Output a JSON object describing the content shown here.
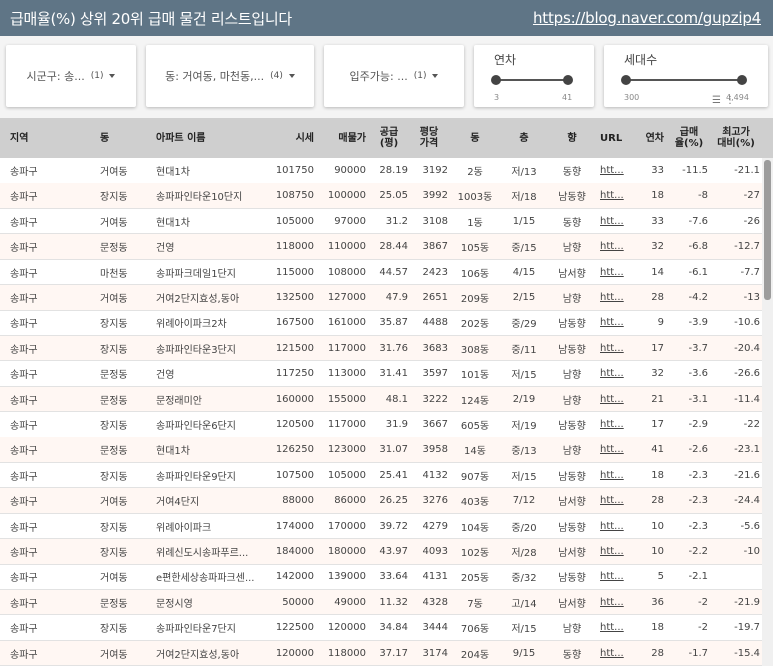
{
  "header": {
    "title": "급매율(%) 상위 20위 급매 물건 리스트입니다",
    "link": "https://blog.naver.com/gupzip4"
  },
  "filters": {
    "sigungu": {
      "label": "시군구: 송...",
      "count": "(1)"
    },
    "dong": {
      "label": "동: 거여동, 마천동,...",
      "count": "(4)"
    },
    "movein": {
      "label": "입주가능: ...",
      "count": "(1)"
    },
    "year": {
      "title": "연차",
      "min": "3",
      "max": "41",
      "range_low": 0.0,
      "range_high": 1.0
    },
    "households": {
      "title": "세대수",
      "min": "300",
      "max": "4,494",
      "range_low": 0.0,
      "range_high": 1.0
    }
  },
  "table": {
    "columns": [
      {
        "key": "region",
        "label": "지역"
      },
      {
        "key": "dong",
        "label": "동"
      },
      {
        "key": "apt",
        "label": "아파트 이름"
      },
      {
        "key": "price",
        "label": "시세"
      },
      {
        "key": "sale",
        "label": "매물가"
      },
      {
        "key": "area",
        "label": "공급\n(평)"
      },
      {
        "key": "ppa",
        "label": "평당\n가격"
      },
      {
        "key": "bldg",
        "label": "동"
      },
      {
        "key": "floor",
        "label": "층"
      },
      {
        "key": "dir",
        "label": "향"
      },
      {
        "key": "url",
        "label": "URL"
      },
      {
        "key": "age",
        "label": "연차"
      },
      {
        "key": "rate",
        "label": "급매\n율(%)"
      },
      {
        "key": "peak",
        "label": "최고가\n대비(%)"
      }
    ],
    "rows": [
      [
        "송파구",
        "거여동",
        "현대1차",
        "101750",
        "90000",
        "28.19",
        "3192",
        "2동",
        "저/13",
        "동향",
        "htt...",
        "33",
        "-11.5",
        "-21.1"
      ],
      [
        "송파구",
        "장지동",
        "송파파인타운10단지",
        "108750",
        "100000",
        "25.05",
        "3992",
        "1003동",
        "저/18",
        "남동향",
        "htt...",
        "18",
        "-8",
        "-27"
      ],
      [
        "송파구",
        "거여동",
        "현대1차",
        "105000",
        "97000",
        "31.2",
        "3108",
        "1동",
        "1/15",
        "동향",
        "htt...",
        "33",
        "-7.6",
        "-26"
      ],
      [
        "송파구",
        "문정동",
        "건영",
        "118000",
        "110000",
        "28.44",
        "3867",
        "105동",
        "중/15",
        "남향",
        "htt...",
        "32",
        "-6.8",
        "-12.7"
      ],
      [
        "송파구",
        "마천동",
        "송파파크데일1단지",
        "115000",
        "108000",
        "44.57",
        "2423",
        "106동",
        "4/15",
        "남서향",
        "htt...",
        "14",
        "-6.1",
        "-7.7"
      ],
      [
        "송파구",
        "거여동",
        "거여2단지효성,동아",
        "132500",
        "127000",
        "47.9",
        "2651",
        "209동",
        "2/15",
        "남향",
        "htt...",
        "28",
        "-4.2",
        "-13"
      ],
      [
        "송파구",
        "장지동",
        "위례아이파크2차",
        "167500",
        "161000",
        "35.87",
        "4488",
        "202동",
        "중/29",
        "남동향",
        "htt...",
        "9",
        "-3.9",
        "-10.6"
      ],
      [
        "송파구",
        "장지동",
        "송파파인타운3단지",
        "121500",
        "117000",
        "31.76",
        "3683",
        "308동",
        "중/11",
        "남동향",
        "htt...",
        "17",
        "-3.7",
        "-20.4"
      ],
      [
        "송파구",
        "문정동",
        "건영",
        "117250",
        "113000",
        "31.41",
        "3597",
        "101동",
        "저/15",
        "남향",
        "htt...",
        "32",
        "-3.6",
        "-26.6"
      ],
      [
        "송파구",
        "문정동",
        "문정래미안",
        "160000",
        "155000",
        "48.1",
        "3222",
        "124동",
        "2/19",
        "남향",
        "htt...",
        "21",
        "-3.1",
        "-11.4"
      ],
      [
        "송파구",
        "장지동",
        "송파파인타운6단지",
        "120500",
        "117000",
        "31.9",
        "3667",
        "605동",
        "저/19",
        "남동향",
        "htt...",
        "17",
        "-2.9",
        "-22"
      ],
      [
        "송파구",
        "문정동",
        "현대1차",
        "126250",
        "123000",
        "31.07",
        "3958",
        "14동",
        "중/13",
        "남향",
        "htt...",
        "41",
        "-2.6",
        "-23.1"
      ],
      [
        "송파구",
        "장지동",
        "송파파인타운9단지",
        "107500",
        "105000",
        "25.41",
        "4132",
        "907동",
        "저/15",
        "남동향",
        "htt...",
        "18",
        "-2.3",
        "-21.6"
      ],
      [
        "송파구",
        "거여동",
        "거여4단지",
        "88000",
        "86000",
        "26.25",
        "3276",
        "403동",
        "7/12",
        "남서향",
        "htt...",
        "28",
        "-2.3",
        "-24.4"
      ],
      [
        "송파구",
        "장지동",
        "위례아이파크",
        "174000",
        "170000",
        "39.72",
        "4279",
        "104동",
        "중/20",
        "남동향",
        "htt...",
        "10",
        "-2.3",
        "-5.6"
      ],
      [
        "송파구",
        "장지동",
        "위례신도시송파푸르...",
        "184000",
        "180000",
        "43.97",
        "4093",
        "102동",
        "저/28",
        "남서향",
        "htt...",
        "10",
        "-2.2",
        "-10"
      ],
      [
        "송파구",
        "거여동",
        "e편한세상송파파크센...",
        "142000",
        "139000",
        "33.64",
        "4131",
        "205동",
        "중/32",
        "남동향",
        "htt...",
        "5",
        "-2.1",
        ""
      ],
      [
        "송파구",
        "문정동",
        "문정시영",
        "50000",
        "49000",
        "11.32",
        "4328",
        "7동",
        "고/14",
        "남서향",
        "htt...",
        "36",
        "-2",
        "-21.9"
      ],
      [
        "송파구",
        "장지동",
        "송파파인타운7단지",
        "122500",
        "120000",
        "34.84",
        "3444",
        "706동",
        "저/15",
        "남향",
        "htt...",
        "18",
        "-2",
        "-19.7"
      ],
      [
        "송파구",
        "거여동",
        "거여2단지효성,동아",
        "120000",
        "118000",
        "37.17",
        "3174",
        "204동",
        "9/15",
        "동향",
        "htt...",
        "28",
        "-1.7",
        "-15.4"
      ]
    ]
  },
  "icons": [
    "filter-icon",
    "more-vert-icon",
    "caret-down-icon"
  ]
}
